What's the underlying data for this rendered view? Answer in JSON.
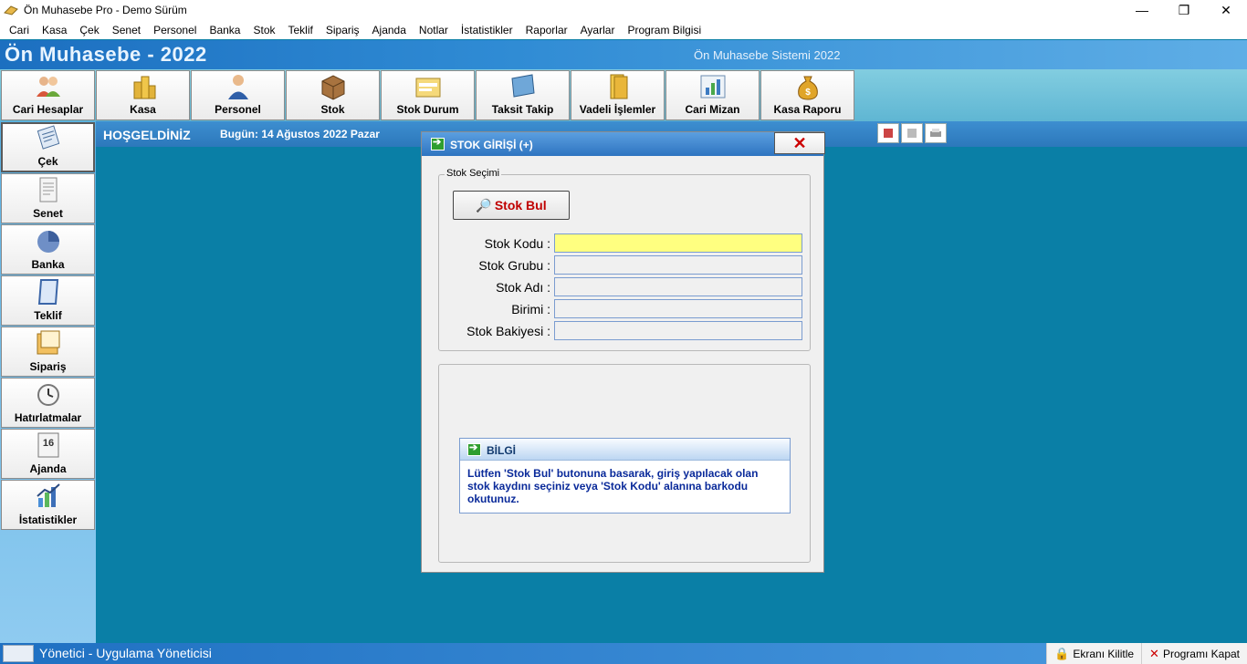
{
  "window": {
    "title": "Ön Muhasebe Pro - Demo Sürüm"
  },
  "menu": [
    "Cari",
    "Kasa",
    "Çek",
    "Senet",
    "Personel",
    "Banka",
    "Stok",
    "Teklif",
    "Sipariş",
    "Ajanda",
    "Notlar",
    "İstatistikler",
    "Raporlar",
    "Ayarlar",
    "Program Bilgisi"
  ],
  "banner": {
    "app_name": "Ön Muhasebe - 2022",
    "system_name": "Ön Muhasebe Sistemi 2022"
  },
  "toolbar": [
    {
      "label": "Cari Hesaplar",
      "icon": "users-icon"
    },
    {
      "label": "Kasa",
      "icon": "coins-icon"
    },
    {
      "label": "Personel",
      "icon": "person-icon"
    },
    {
      "label": "Stok",
      "icon": "box-icon"
    },
    {
      "label": "Stok Durum",
      "icon": "folder-icon"
    },
    {
      "label": "Taksit Takip",
      "icon": "monitor-icon"
    },
    {
      "label": "Vadeli İşlemler",
      "icon": "files-icon"
    },
    {
      "label": "Cari Mizan",
      "icon": "chart-icon"
    },
    {
      "label": "Kasa Raporu",
      "icon": "money-bag-icon"
    }
  ],
  "sidebar": [
    {
      "label": "Çek",
      "icon": "cheque-icon"
    },
    {
      "label": "Senet",
      "icon": "document-icon"
    },
    {
      "label": "Banka",
      "icon": "pie-icon"
    },
    {
      "label": "Teklif",
      "icon": "notebook-icon"
    },
    {
      "label": "Sipariş",
      "icon": "order-icon"
    },
    {
      "label": "Hatırlatmalar",
      "icon": "clock-icon"
    },
    {
      "label": "Ajanda",
      "icon": "calendar-icon"
    },
    {
      "label": "İstatistikler",
      "icon": "stats-icon"
    }
  ],
  "welcome": {
    "text": "HOŞGELDİNİZ",
    "today": "Bugün: 14 Ağustos 2022 Pazar"
  },
  "dialog": {
    "title": "STOK GİRİŞİ (+)",
    "legend": "Stok Seçimi",
    "stok_bul": "Stok Bul",
    "fields": [
      {
        "label": "Stok Kodu :",
        "value": ""
      },
      {
        "label": "Stok Grubu :",
        "value": ""
      },
      {
        "label": "Stok Adı :",
        "value": ""
      },
      {
        "label": "Birimi :",
        "value": ""
      },
      {
        "label": "Stok Bakiyesi :",
        "value": ""
      }
    ],
    "info": {
      "title": "BİLGİ",
      "text": "Lütfen 'Stok Bul' butonuna basarak, giriş yapılacak olan stok kaydını seçiniz veya 'Stok Kodu' alanına barkodu okutunuz."
    }
  },
  "statusbar": {
    "user": "Yönetici - Uygulama Yöneticisi",
    "lock": "Ekranı Kilitle",
    "close": "Programı Kapat"
  }
}
